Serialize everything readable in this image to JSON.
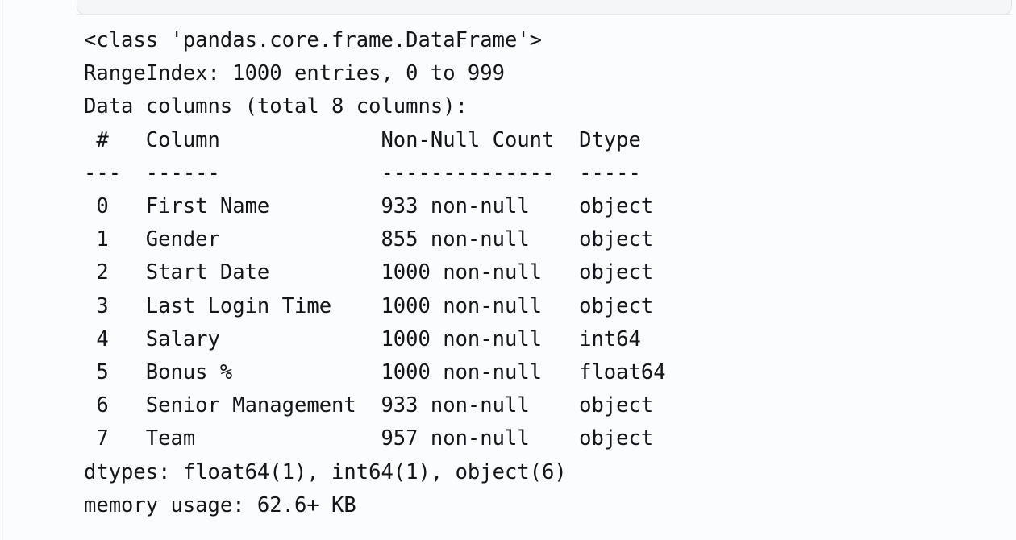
{
  "output": {
    "kind": "pandas-dataframe-info",
    "header_lines": [
      "<class 'pandas.core.frame.DataFrame'>",
      "RangeIndex: 1000 entries, 0 to 999",
      "Data columns (total 8 columns):"
    ],
    "class_name": "<class 'pandas.core.frame.DataFrame'>",
    "range_index": "RangeIndex: 1000 entries, 0 to 999",
    "data_columns_line": "Data columns (total 8 columns):",
    "table": {
      "headers": [
        "#",
        "Column",
        "Non-Null Count",
        "Dtype"
      ],
      "separators": [
        "---",
        "------",
        "--------------",
        "-----"
      ],
      "rows": [
        {
          "index": "0",
          "column": "First Name",
          "non_null": "933 non-null",
          "dtype": "object"
        },
        {
          "index": "1",
          "column": "Gender",
          "non_null": "855 non-null",
          "dtype": "object"
        },
        {
          "index": "2",
          "column": "Start Date",
          "non_null": "1000 non-null",
          "dtype": "object"
        },
        {
          "index": "3",
          "column": "Last Login Time",
          "non_null": "1000 non-null",
          "dtype": "object"
        },
        {
          "index": "4",
          "column": "Salary",
          "non_null": "1000 non-null",
          "dtype": "int64"
        },
        {
          "index": "5",
          "column": "Bonus %",
          "non_null": "1000 non-null",
          "dtype": "float64"
        },
        {
          "index": "6",
          "column": "Senior Management",
          "non_null": "933 non-null",
          "dtype": "object"
        },
        {
          "index": "7",
          "column": "Team",
          "non_null": "957 non-null",
          "dtype": "object"
        }
      ]
    },
    "footer_lines": [
      "dtypes: float64(1), int64(1), object(6)",
      "memory usage: 62.6+ KB"
    ],
    "dtypes_summary": "dtypes: float64(1), int64(1), object(6)",
    "memory_usage": "memory usage: 62.6+ KB",
    "full_text": "<class 'pandas.core.frame.DataFrame'>\nRangeIndex: 1000 entries, 0 to 999\nData columns (total 8 columns):\n #   Column             Non-Null Count  Dtype  \n---  ------             --------------  -----  \n 0   First Name         933 non-null    object \n 1   Gender             855 non-null    object \n 2   Start Date         1000 non-null   object \n 3   Last Login Time    1000 non-null   object \n 4   Salary             1000 non-null   int64  \n 5   Bonus %            1000 non-null   float64\n 6   Senior Management  933 non-null    object \n 7   Team               957 non-null    object \ndtypes: float64(1), int64(1), object(6)\nmemory usage: 62.6+ KB"
  },
  "colors": {
    "background": "#fbfcfd",
    "text": "#15151c",
    "panel_border": "#dfe3e8",
    "panel_fill": "#f4f6f8",
    "rule": "#eef1f5"
  }
}
